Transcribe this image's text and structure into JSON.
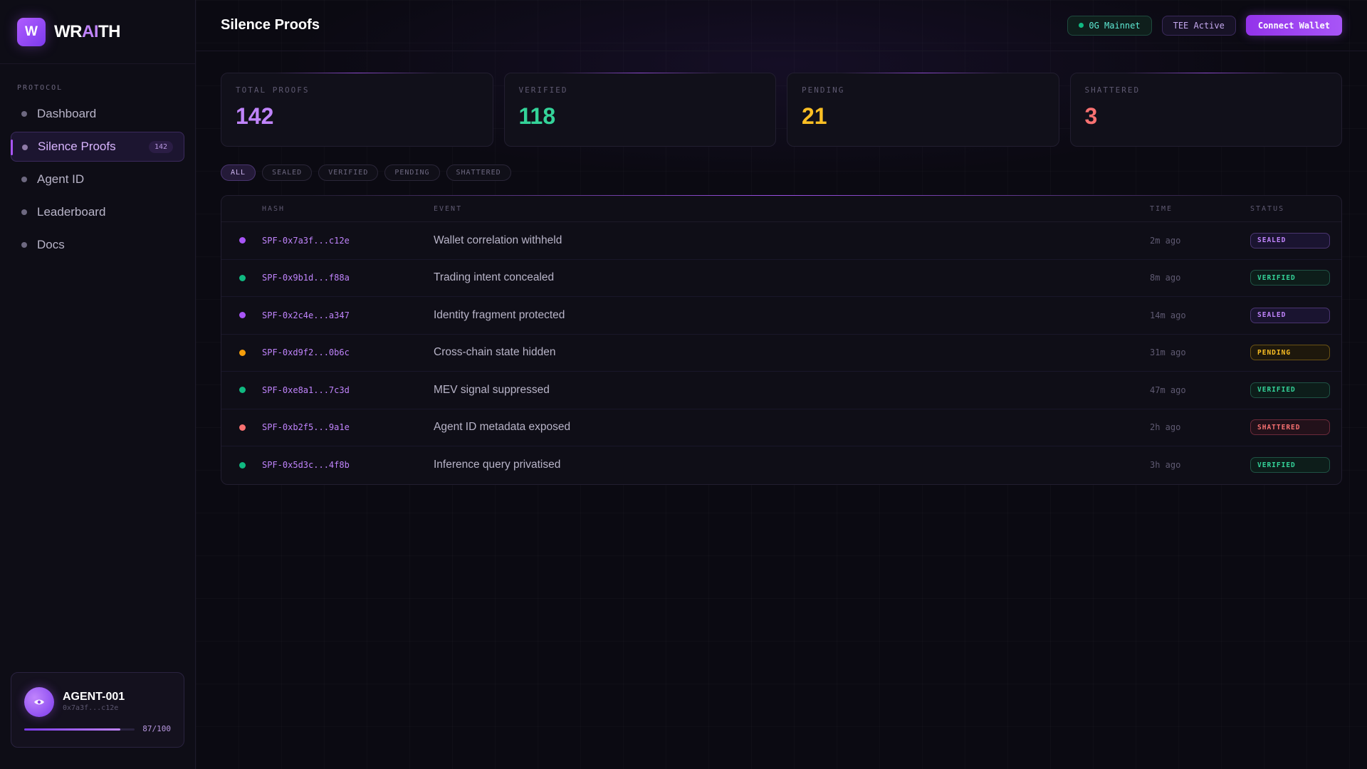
{
  "brand": {
    "logo_letter": "W",
    "name_part1": "WR",
    "name_part2": "AI",
    "name_part3": "TH"
  },
  "sidebar": {
    "section_label": "PROTOCOL",
    "items": [
      {
        "label": "Dashboard"
      },
      {
        "label": "Silence Proofs",
        "badge": "142",
        "active": true
      },
      {
        "label": "Agent ID"
      },
      {
        "label": "Leaderboard"
      },
      {
        "label": "Docs"
      }
    ],
    "agent": {
      "name": "AGENT-001",
      "address": "0x7a3f...c12e",
      "score_text": "87/100",
      "score_fraction": 0.87,
      "icon": "eye-icon"
    }
  },
  "header": {
    "title": "Silence Proofs",
    "network_label": "0G Mainnet",
    "tee_label": "TEE Active",
    "connect_label": "Connect Wallet"
  },
  "stats": [
    {
      "label": "TOTAL PROOFS",
      "value": "142",
      "color": "#c084fc"
    },
    {
      "label": "VERIFIED",
      "value": "118",
      "color": "#34d399"
    },
    {
      "label": "PENDING",
      "value": "21",
      "color": "#fbbf24"
    },
    {
      "label": "SHATTERED",
      "value": "3",
      "color": "#f87171"
    }
  ],
  "filters": [
    "ALL",
    "SEALED",
    "VERIFIED",
    "PENDING",
    "SHATTERED"
  ],
  "table": {
    "headers": {
      "hash": "HASH",
      "event": "EVENT",
      "time": "TIME",
      "status": "STATUS"
    },
    "rows": [
      {
        "hash": "SPF-0x7a3f...c12e",
        "event": "Wallet correlation withheld",
        "time": "2m ago",
        "status": "SEALED"
      },
      {
        "hash": "SPF-0x9b1d...f88a",
        "event": "Trading intent concealed",
        "time": "8m ago",
        "status": "VERIFIED"
      },
      {
        "hash": "SPF-0x2c4e...a347",
        "event": "Identity fragment protected",
        "time": "14m ago",
        "status": "SEALED"
      },
      {
        "hash": "SPF-0xd9f2...0b6c",
        "event": "Cross-chain state hidden",
        "time": "31m ago",
        "status": "PENDING"
      },
      {
        "hash": "SPF-0xe8a1...7c3d",
        "event": "MEV signal suppressed",
        "time": "47m ago",
        "status": "VERIFIED"
      },
      {
        "hash": "SPF-0xb2f5...9a1e",
        "event": "Agent ID metadata exposed",
        "time": "2h ago",
        "status": "SHATTERED"
      },
      {
        "hash": "SPF-0x5d3c...4f8b",
        "event": "Inference query privatised",
        "time": "3h ago",
        "status": "VERIFIED"
      }
    ]
  },
  "status_colors": {
    "SEALED": "#a855f7",
    "VERIFIED": "#10b981",
    "PENDING": "#f59e0b",
    "SHATTERED": "#f87171"
  }
}
